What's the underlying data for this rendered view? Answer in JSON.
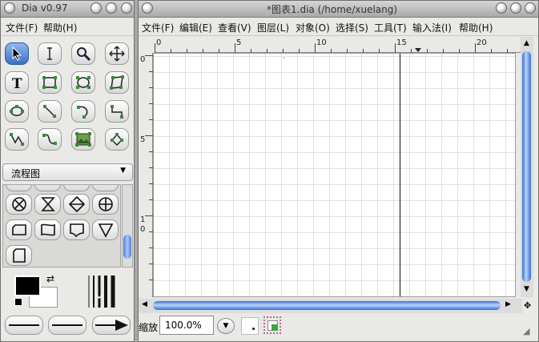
{
  "toolbox": {
    "title": "Dia v0.97",
    "menu": {
      "file": "文件(F)",
      "help": "帮助(H)"
    },
    "sheet_selected": "流程图",
    "tools": [
      "pointer-tool",
      "text-edit-tool",
      "magnify-tool",
      "scroll-tool",
      "text-tool",
      "box-tool",
      "ellipse-tool",
      "polygon-tool",
      "beziergon-tool",
      "line-tool",
      "arc-tool",
      "zigzagline-tool",
      "polyline-tool",
      "bezierline-tool",
      "image-tool",
      "outline-tool"
    ],
    "shapes": [
      "flowchart-or-shape",
      "flowchart-collate-shape",
      "flowchart-sort-shape",
      "flowchart-summing-junction-shape",
      "flowchart-manual-input-shape",
      "flowchart-punched-tape-shape",
      "flowchart-document-shape",
      "flowchart-merge-shape",
      "flowchart-offline-storage-shape"
    ],
    "colors": {
      "foreground": "#000000",
      "background": "#ffffff"
    }
  },
  "diagram": {
    "title": "*图表1.dia (/home/xuelang)",
    "menu": {
      "file": "文件(F)",
      "edit": "编辑(E)",
      "view": "查看(V)",
      "layers": "图层(L)",
      "objects": "对象(O)",
      "select": "选择(S)",
      "tools": "工具(T)",
      "input_method": "输入法(I)",
      "help": "帮助(H)"
    },
    "ruler_h_labels": [
      "0",
      "5",
      "10",
      "15",
      "20"
    ],
    "ruler_v_labels": [
      "0",
      "5",
      "1",
      "0"
    ],
    "status": {
      "zoom_label": "缩放",
      "zoom_value": "100.0%"
    }
  }
}
